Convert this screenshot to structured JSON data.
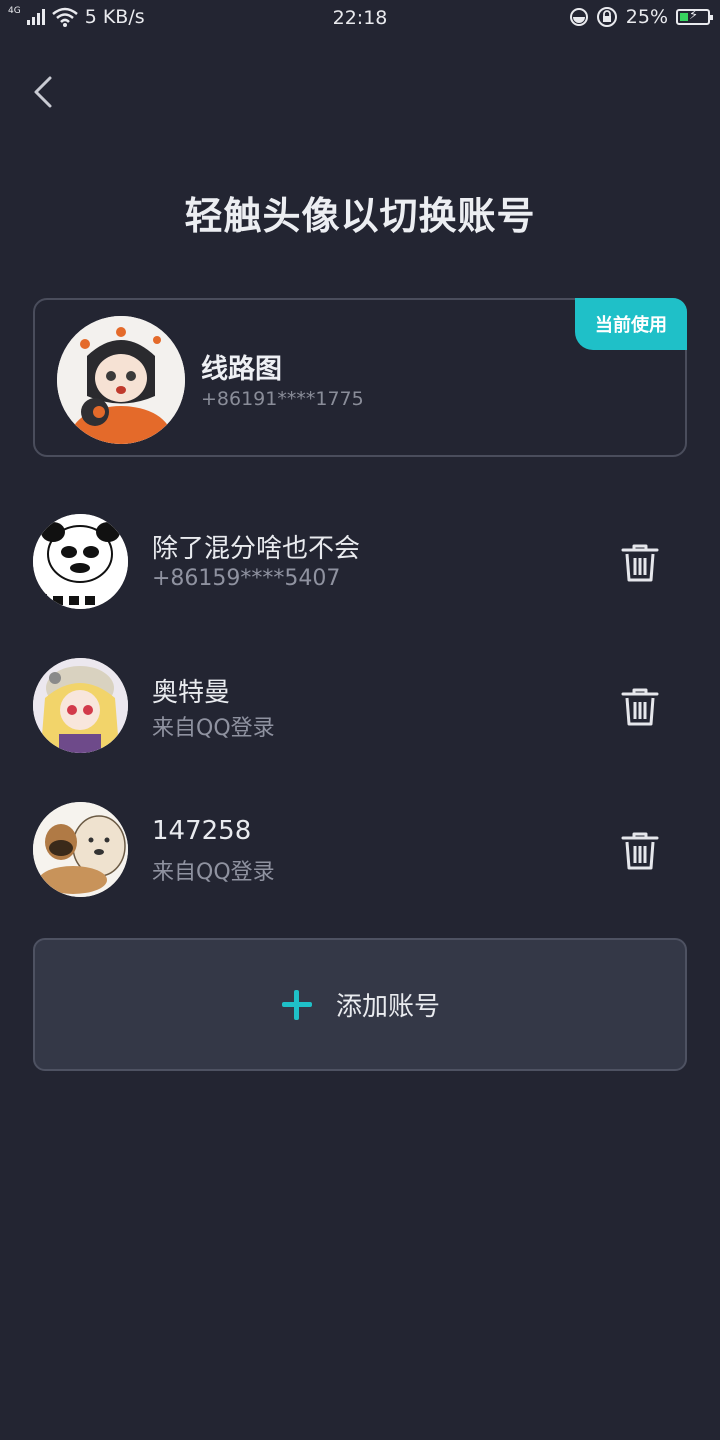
{
  "status_bar": {
    "network_type": "4G",
    "speed": "5 KB/s",
    "time": "22:18",
    "battery": "25%",
    "icons": [
      "signal-icon",
      "wifi-icon",
      "data-saver-icon",
      "rotation-lock-icon",
      "battery-charging-icon"
    ]
  },
  "header": {
    "title": "轻触头像以切换账号"
  },
  "current_account": {
    "name": "线路图",
    "phone": "+86191****1775",
    "badge": "当前使用"
  },
  "accounts": [
    {
      "name": "除了混分啥也不会",
      "sub": "+86159****5407"
    },
    {
      "name": "奥特曼",
      "sub": "来自QQ登录"
    },
    {
      "name": "147258",
      "sub": "来自QQ登录"
    }
  ],
  "add_account": {
    "label": "添加账号"
  },
  "colors": {
    "background": "#232532",
    "accent": "#1fc0c8",
    "card_border": "#4a4d5c",
    "button_bg": "#343847"
  }
}
